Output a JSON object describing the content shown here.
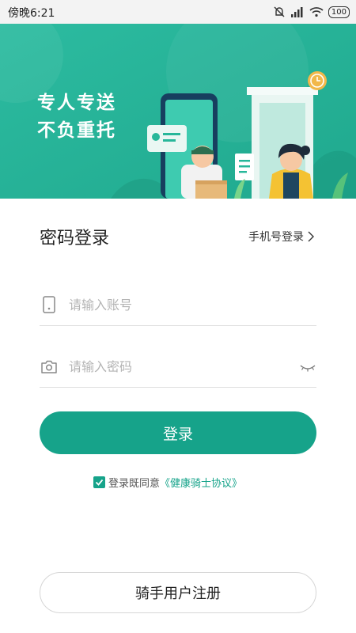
{
  "status_bar": {
    "time": "傍晚6:21",
    "battery": "100"
  },
  "banner": {
    "line1": "专人专送",
    "line2": "不负重托"
  },
  "login": {
    "title": "密码登录",
    "switch_link": "手机号登录",
    "account_placeholder": "请输入账号",
    "password_placeholder": "请输入密码",
    "submit_label": "登录",
    "agreement_prefix": "登录既同意",
    "agreement_link": "《健康骑士协议》",
    "agreement_checked": true
  },
  "register": {
    "label": "骑手用户注册"
  },
  "colors": {
    "accent": "#16a38a",
    "banner_bg": "#27b79a"
  }
}
